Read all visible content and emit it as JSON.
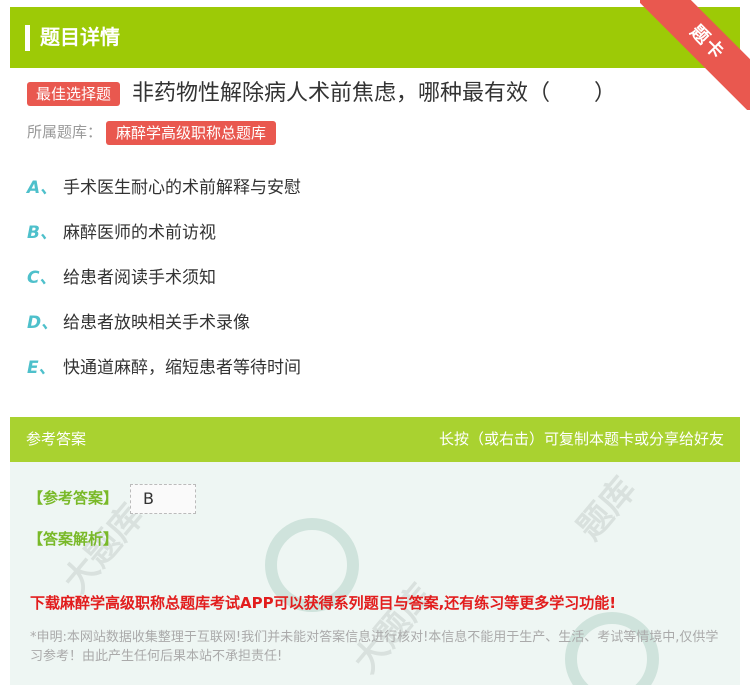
{
  "header": {
    "title": "题目详情",
    "ribbon": "题卡"
  },
  "question": {
    "type_tag": "最佳选择题",
    "text": "非药物性解除病人术前焦虑，哪种最有效（　　）",
    "source_label": "所属题库：",
    "source_tag": "麻醉学高级职称总题库"
  },
  "options": [
    {
      "letter": "A、",
      "text": "手术医生耐心的术前解释与安慰"
    },
    {
      "letter": "B、",
      "text": "麻醉医师的术前访视"
    },
    {
      "letter": "C、",
      "text": "给患者阅读手术须知"
    },
    {
      "letter": "D、",
      "text": "给患者放映相关手术录像"
    },
    {
      "letter": "E、",
      "text": "快通道麻醉，缩短患者等待时间"
    }
  ],
  "answer_bar": {
    "left": "参考答案",
    "right": "长按（或右击）可复制本题卡或分享给好友"
  },
  "answer": {
    "ref_label": "【参考答案】",
    "ref_value": "B",
    "analysis_label": "【答案解析】",
    "promo": "下载麻醉学高级职称总题库考试APP可以获得系列题目与答案,还有练习等更多学习功能!",
    "disclaimer": "*申明:本网站数据收集整理于互联网!我们并未能对答案信息进行核对!本信息不能用于生产、生活、考试等情境中,仅供学习参考！由此产生任何后果本站不承担责任!"
  }
}
